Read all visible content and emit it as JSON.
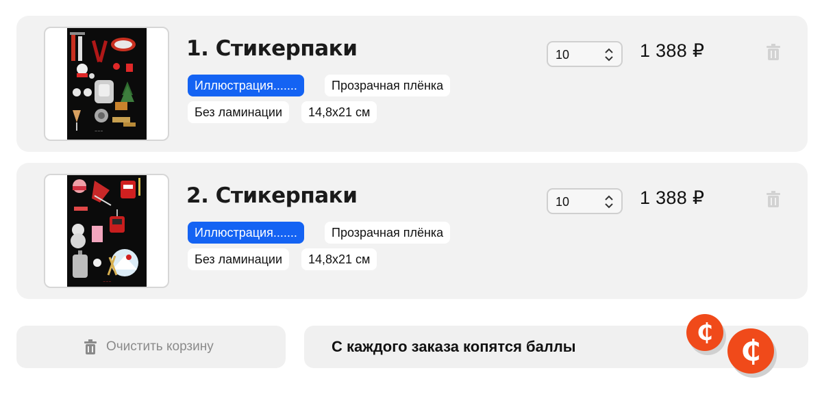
{
  "cart": {
    "items": [
      {
        "title": "1. Стикерпаки",
        "tags": [
          "Иллюстрация.......",
          "Прозрачная плёнка",
          "Без ламинации",
          "14,8x21 см"
        ],
        "quantity": "10",
        "price": "1 388 ₽",
        "thumbnail": "sticker-sheet-ski-black"
      },
      {
        "title": "2. Стикерпаки",
        "tags": [
          "Иллюстрация.......",
          "Прозрачная плёнка",
          "Без ламинации",
          "14,8x21 см"
        ],
        "quantity": "10",
        "price": "1 388 ₽",
        "thumbnail": "sticker-sheet-winter-travel-black"
      }
    ],
    "clear_label": "Очистить корзину",
    "points_label": "С каждого заказа копятся баллы",
    "coin_glyph": "₵"
  },
  "colors": {
    "accent": "#1463f3",
    "coin": "#f04a1a",
    "card": "#f2f2f2"
  },
  "icons": {
    "trash": "trash-icon",
    "spinner": "spinner-arrows-icon"
  }
}
